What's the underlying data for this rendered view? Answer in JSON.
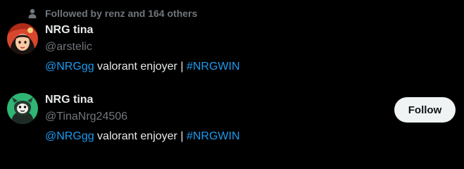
{
  "social_context": {
    "icon": "person-icon",
    "text": "Followed by renz and 164 others"
  },
  "users": [
    {
      "display_name": "NRG tina",
      "handle": "@arstelic",
      "bio_mention": "@NRGgg",
      "bio_text": " valorant enjoyer | ",
      "bio_hashtag": "#NRGWIN",
      "avatar_icon": "anime-avatar"
    },
    {
      "display_name": "NRG tina",
      "handle": "@TinaNrg24506",
      "bio_mention": "@NRGgg",
      "bio_text": " valorant enjoyer | ",
      "bio_hashtag": "#NRGWIN",
      "avatar_icon": "green-character-avatar",
      "follow_label": "Follow"
    }
  ],
  "colors": {
    "background": "#000000",
    "primary_text": "#e7e9ea",
    "secondary_text": "#71767b",
    "link": "#1d9bf0",
    "button_bg": "#eff3f4",
    "button_text": "#0f1419"
  }
}
